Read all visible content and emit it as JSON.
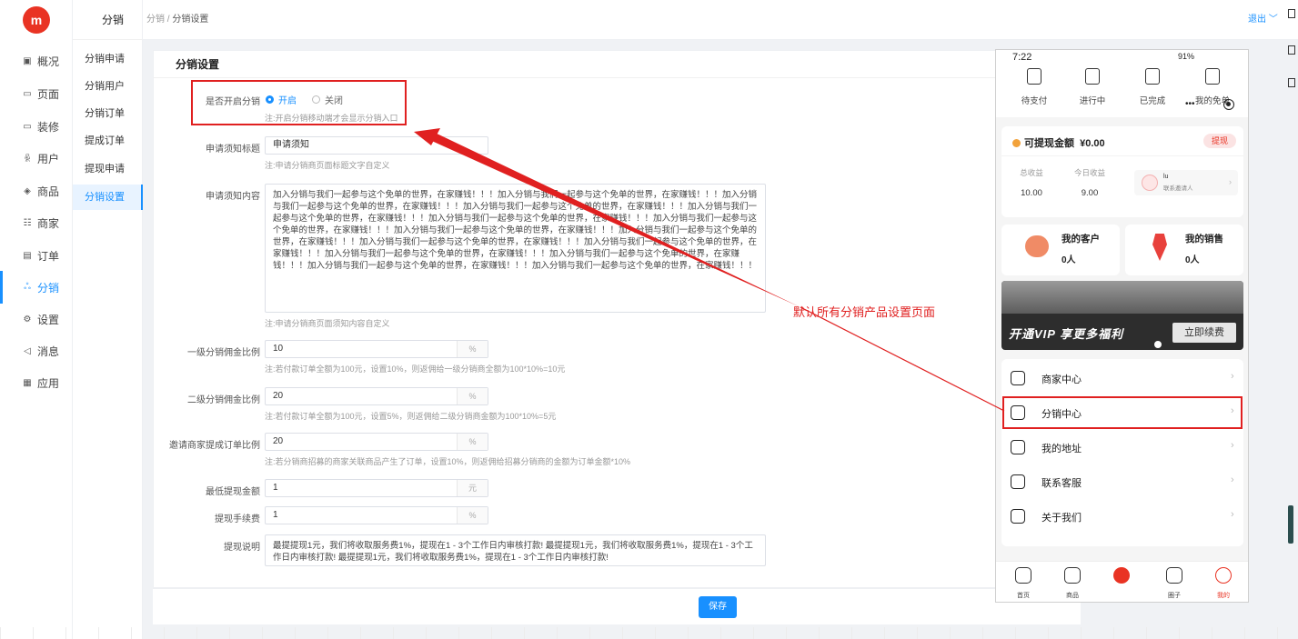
{
  "brand": {
    "logo_text": "m",
    "color": "#e93323",
    "accent": "#1890ff"
  },
  "rail": {
    "items": [
      {
        "label": "概况",
        "icon": "dashboard-icon"
      },
      {
        "label": "页面",
        "icon": "page-icon"
      },
      {
        "label": "装修",
        "icon": "decorate-icon"
      },
      {
        "label": "用户",
        "icon": "user-icon"
      },
      {
        "label": "商品",
        "icon": "goods-icon"
      },
      {
        "label": "商家",
        "icon": "store-icon"
      },
      {
        "label": "订单",
        "icon": "order-icon"
      },
      {
        "label": "分销",
        "icon": "distribution-icon",
        "active": true
      },
      {
        "label": "设置",
        "icon": "settings-icon"
      },
      {
        "label": "消息",
        "icon": "message-icon"
      },
      {
        "label": "应用",
        "icon": "apps-icon"
      }
    ]
  },
  "sub": {
    "title": "分销",
    "items": [
      {
        "label": "分销申请"
      },
      {
        "label": "分销用户"
      },
      {
        "label": "分销订单"
      },
      {
        "label": "提成订单"
      },
      {
        "label": "提现申请"
      },
      {
        "label": "分销设置",
        "active": true
      }
    ]
  },
  "header": {
    "crumb_root": "分销",
    "crumb_sep": "/",
    "crumb_current": "分销设置",
    "logout": "退出 ﹀"
  },
  "form": {
    "title": "分销设置",
    "enable": {
      "label": "是否开启分销",
      "on": "开启",
      "off": "关闭",
      "tip": "注:开启分销移动端才会显示分销入口"
    },
    "notice_title": {
      "label": "申请须知标题",
      "value": "申请须知",
      "tip": "注:申请分销商页面标题文字自定义"
    },
    "notice_content": {
      "label": "申请须知内容",
      "value": "加入分销与我们一起参与这个免单的世界，在家赚钱！！！加入分销与我们一起参与这个免单的世界，在家赚钱！！！加入分销与我们一起参与这个免单的世界，在家赚钱！！！加入分销与我们一起参与这个免单的世界，在家赚钱！！！加入分销与我们一起参与这个免单的世界，在家赚钱！！！加入分销与我们一起参与这个免单的世界，在家赚钱！！！加入分销与我们一起参与这个免单的世界，在家赚钱！！！加入分销与我们一起参与这个免单的世界，在家赚钱！！！加入分销与我们一起参与这个免单的世界，在家赚钱！！！加入分销与我们一起参与这个免单的世界，在家赚钱！！！加入分销与我们一起参与这个免单的世界，在家赚钱！！！加入分销与我们一起参与这个免单的世界，在家赚钱！！！加入分销与我们一起参与这个免单的世界，在家赚钱！！！加入分销与我们一起参与这个免单的世界，在家赚钱！！！加入分销与我们一起参与这个免单的世界，在家赚钱！！！",
      "tip": "注:申请分销商页面须知内容自定义"
    },
    "level1": {
      "label": "一级分销佣金比例",
      "value": "10",
      "suffix": "%",
      "tip": "注:若付款订单全额为100元，设置10%，则返佣给一级分销商全额为100*10%=10元"
    },
    "level2": {
      "label": "二级分销佣金比例",
      "value": "20",
      "suffix": "%",
      "tip": "注:若付款订单全额为100元，设置5%，则返佣给二级分销商金额为100*10%=5元"
    },
    "invite": {
      "label": "邀请商家提成订单比例",
      "value": "20",
      "suffix": "%",
      "tip": "注:若分销商招募的商家关联商品产生了订单，设置10%，则返佣给招募分销商的金额为订单金额*10%"
    },
    "min_withdraw": {
      "label": "最低提现金额",
      "value": "1",
      "suffix": "元"
    },
    "fee": {
      "label": "提现手续费",
      "value": "1",
      "suffix": "%"
    },
    "withdraw_desc": {
      "label": "提现说明",
      "value": "最提提现1元，我们将收取服务费1%，提现在1 - 3个工作日内审核打款! 最提提现1元，我们将收取服务费1%，提现在1 - 3个工作日内审核打款! 最提提现1元，我们将收取服务费1%，提现在1 - 3个工作日内审核打款!"
    },
    "save": "保存"
  },
  "annotation": "默认所有分销产品设置页面",
  "phone": {
    "time": "7:22",
    "status_right": "91%",
    "orders": [
      "待支付",
      "进行中",
      "已完成",
      "我的免单"
    ],
    "wallet": {
      "title": "可提现金额",
      "amount": "¥0.00",
      "withdraw": "提现",
      "total_label": "总收益",
      "total_value": "10.00",
      "today_label": "今日收益",
      "today_value": "9.00",
      "inviter_name": "lu",
      "inviter_sub": "联系邀请人"
    },
    "customers": {
      "title": "我的客户",
      "value": "0人"
    },
    "sales": {
      "title": "我的销售",
      "value": "0人"
    },
    "vip": {
      "text": "开通VIP 享更多福利",
      "button": "立即续费"
    },
    "menu": [
      {
        "label": "商家中心",
        "icon": "store-icon"
      },
      {
        "label": "分销中心",
        "icon": "distribution-icon",
        "highlight": true
      },
      {
        "label": "我的地址",
        "icon": "location-icon"
      },
      {
        "label": "联系客服",
        "icon": "headset-icon"
      },
      {
        "label": "关于我们",
        "icon": "info-icon"
      }
    ],
    "tabs": [
      "首页",
      "商品",
      "",
      "圈子",
      "我的"
    ]
  }
}
